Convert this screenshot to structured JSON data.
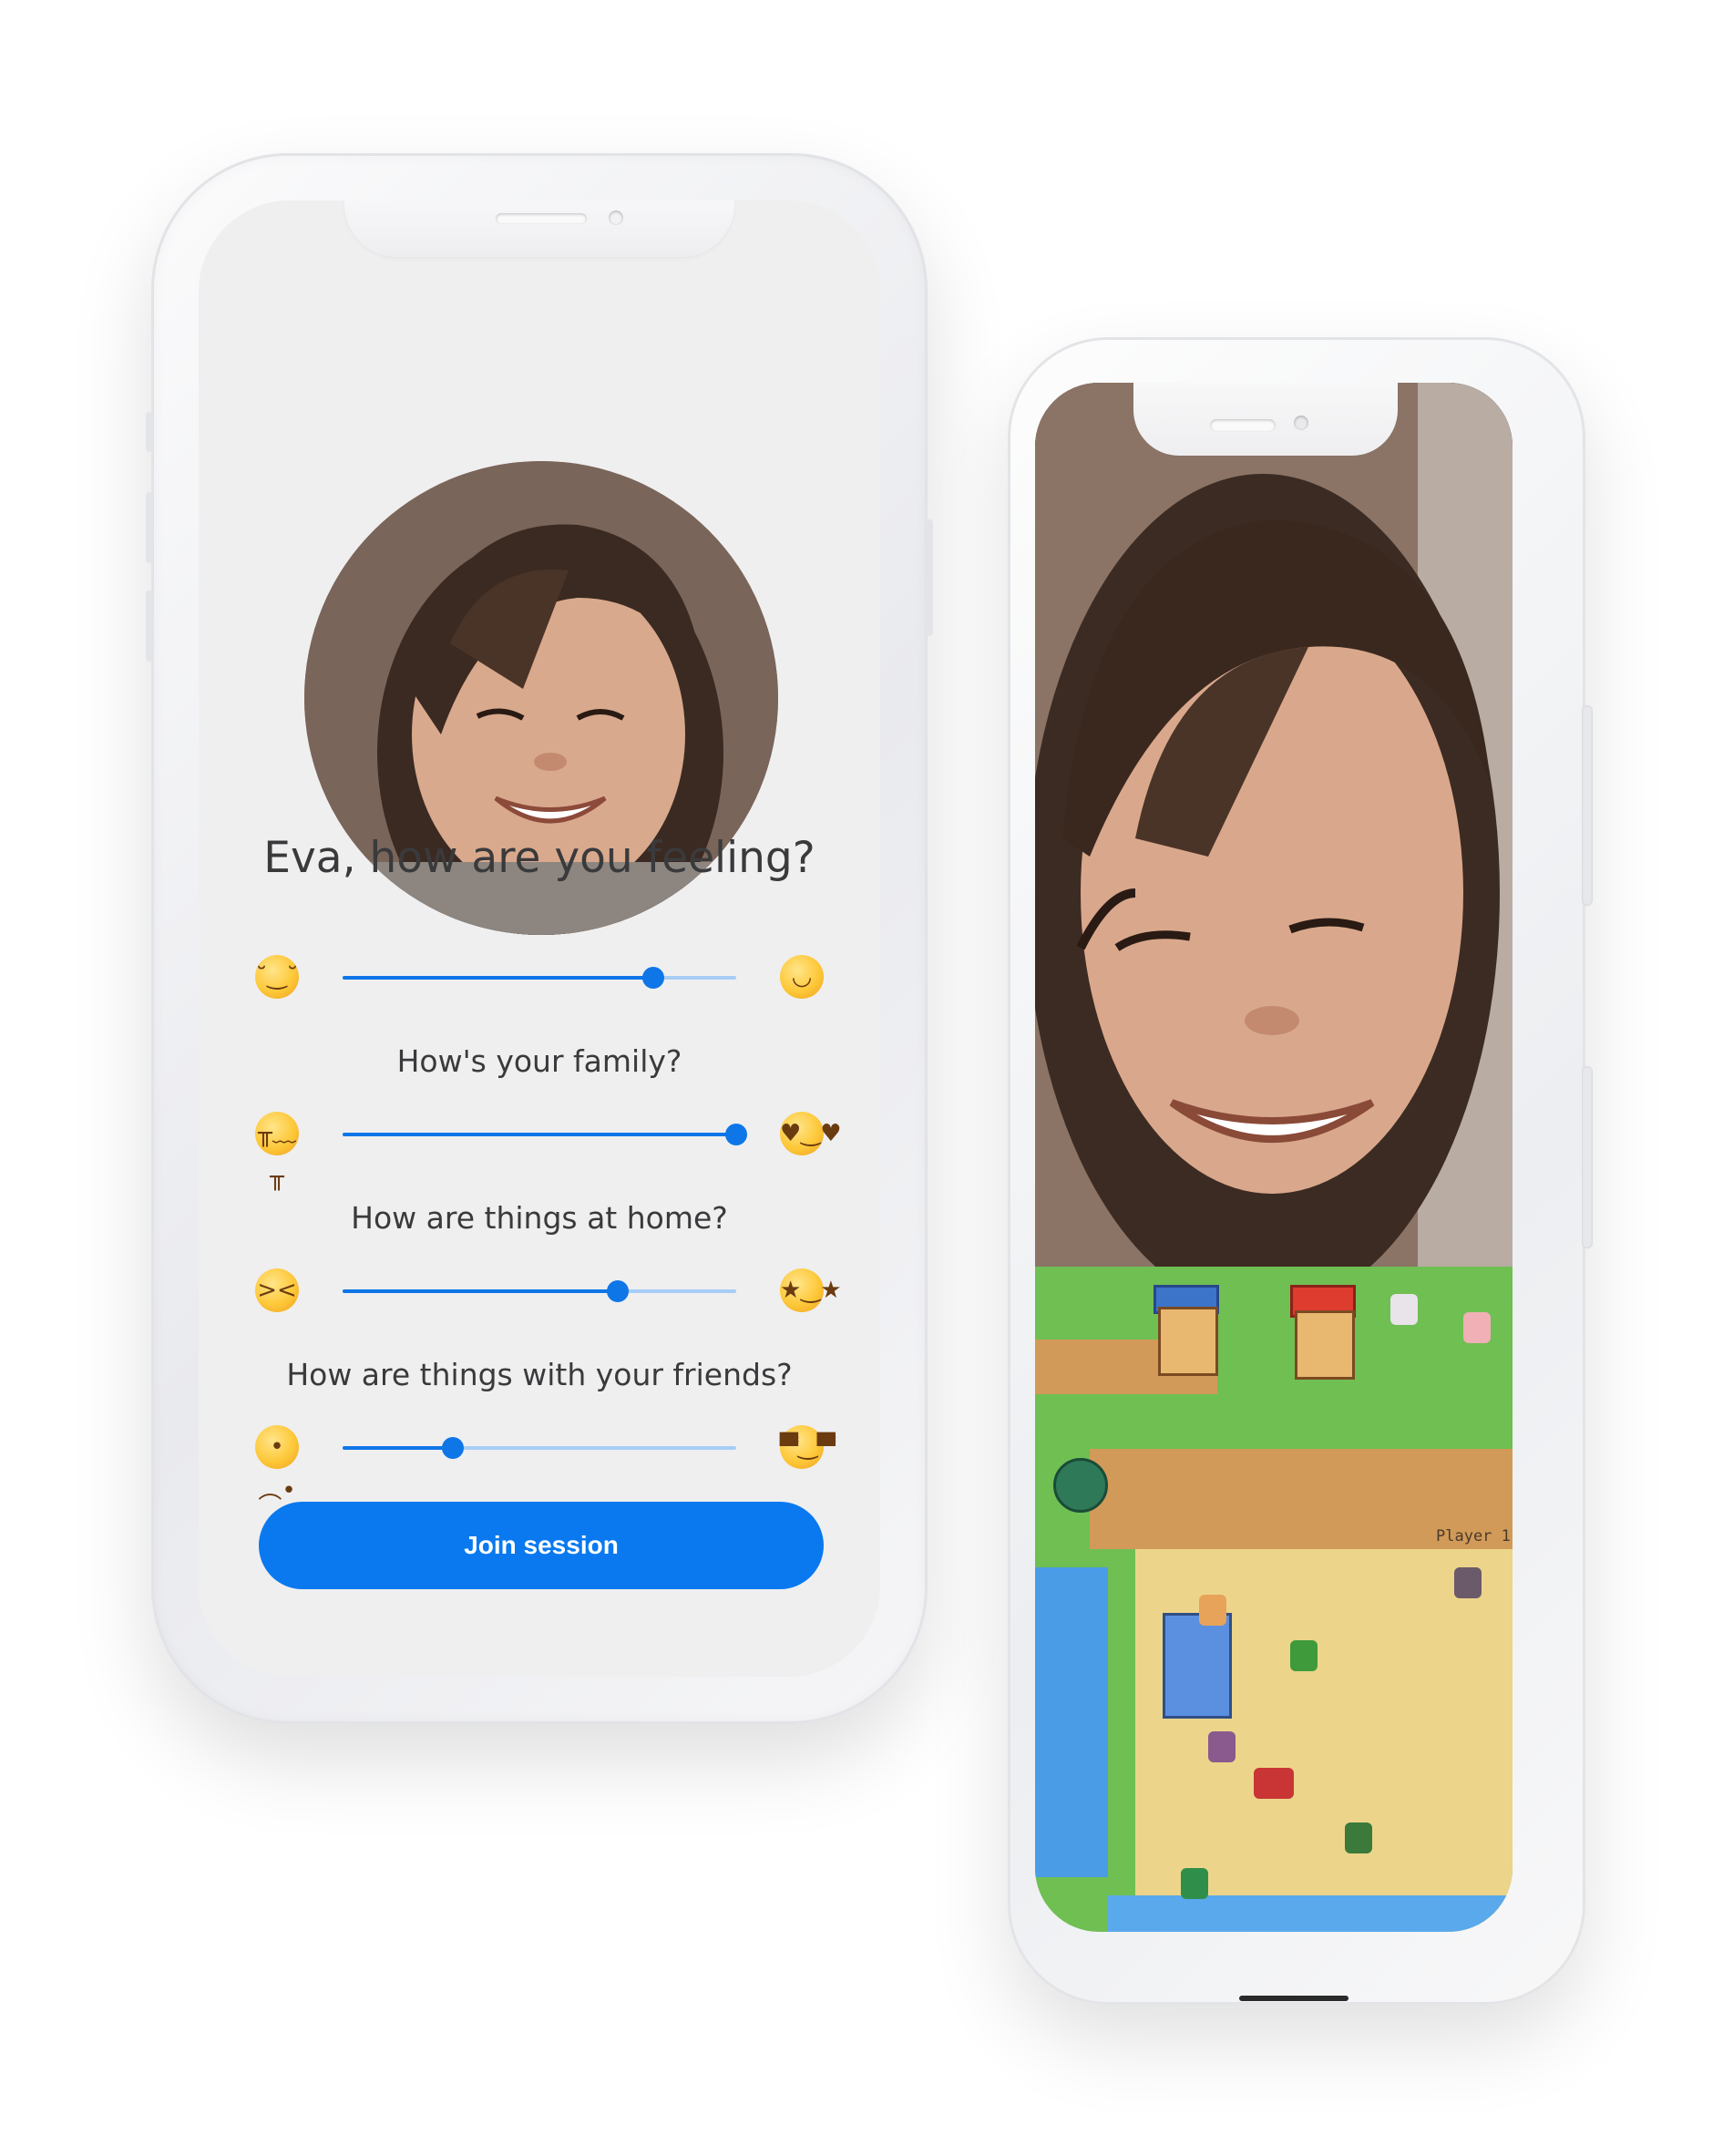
{
  "onboarding": {
    "title": "Eva, how are you feeling?",
    "questions": [
      "How's your family?",
      "How are things at home?",
      "How are things with your friends?"
    ],
    "sliders": [
      {
        "left_icon": "pensive-face-icon",
        "right_icon": "grinning-face-icon",
        "value": 0.79,
        "left_glyph": "˘‿˘",
        "right_glyph": "◡"
      },
      {
        "left_icon": "crying-face-icon",
        "right_icon": "heart-eyes-face-icon",
        "value": 1.0,
        "left_glyph": "╥﹏╥",
        "right_glyph": "♥‿♥"
      },
      {
        "left_icon": "tired-face-icon",
        "right_icon": "star-struck-face-icon",
        "value": 0.7,
        "left_glyph": "><",
        "right_glyph": "★‿★"
      },
      {
        "left_icon": "pleading-face-icon",
        "right_icon": "sunglasses-face-icon",
        "value": 0.28,
        "left_glyph": "•︵•",
        "right_glyph": "▀̿‿▀̿"
      }
    ],
    "join_label": "Join session",
    "accent_color": "#0a79f0"
  },
  "session": {
    "game_label": "Player 1"
  }
}
